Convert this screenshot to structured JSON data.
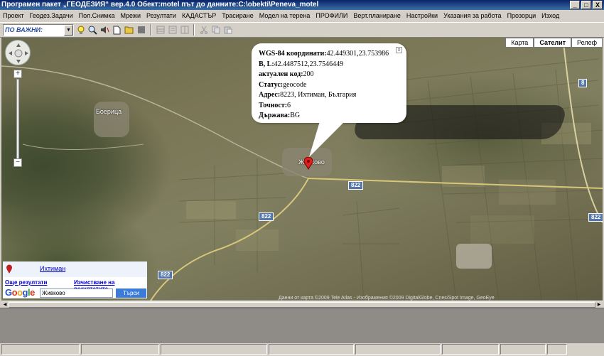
{
  "window": {
    "title": "Програмен пакет „ГЕОДЕЗИЯ“ вер.4.0    Обект:motel    път до данните:C:\\obekti\\Peneva_motel",
    "min_label": "_",
    "max_label": "□",
    "close_label": "X"
  },
  "menu": {
    "items": [
      "Проект",
      "Геодез.Задачи",
      "Пол.Снимка",
      "Мрежи",
      "Резултати",
      "КАДАСТЪР",
      "Трасиране",
      "Модел на терена",
      "ПРОФИЛИ",
      "Верт.планиране",
      "Настройки",
      "Указания за работа",
      "Прозорци",
      "Изход"
    ]
  },
  "toolbar": {
    "combo_value": "ПО ВАЖНИ:",
    "combo_arrow": "▼"
  },
  "map": {
    "type_buttons": [
      "Карта",
      "Сателит",
      "Релеф"
    ],
    "selected_type": "Сателит",
    "town_labels": [
      "Боерица",
      "Живково"
    ],
    "road_shields": [
      "822",
      "822",
      "822",
      "8",
      "822"
    ],
    "copyright": "Данни от карта ©2009 Tele Atlas - Изображения ©2009 DigitalGlobe, Cnes/Spot Image, GeoEye",
    "zoom_plus": "+",
    "zoom_minus": "−"
  },
  "info_window": {
    "close": "x",
    "rows": [
      {
        "label": "WGS-84 координати:",
        "value": "42.449301,23.753986"
      },
      {
        "label": "B, L:",
        "value": "42.4487512,23.7546449"
      },
      {
        "label": "актуален код:",
        "value": "200"
      },
      {
        "label": "Статус:",
        "value": "geocode"
      },
      {
        "label": "Адрес:",
        "value": "8223, Ихтиман, България"
      },
      {
        "label": "Точност:",
        "value": "6"
      },
      {
        "label": "Държава:",
        "value": "BG"
      }
    ]
  },
  "search": {
    "result_link": "Ихтиман",
    "more_results": "Още резултати",
    "clear_results": "Изчистване на резултатите",
    "google_logo": "Google",
    "input_value": "Живково",
    "search_button": "Търси"
  }
}
